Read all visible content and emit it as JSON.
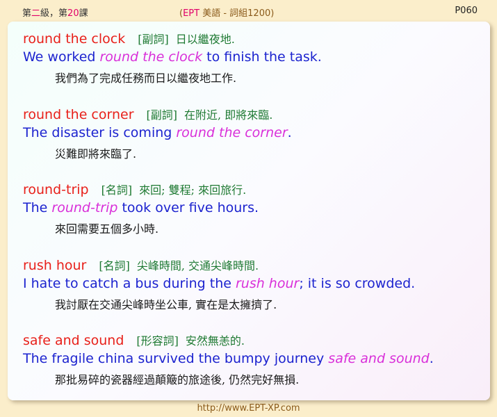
{
  "header": {
    "lesson_prefix": "第",
    "lesson_level": "二",
    "lesson_mid": "級，第",
    "lesson_num": "20",
    "lesson_suffix": "課",
    "book_open": "(",
    "book_ept": "EPT",
    "book_rest": " 美語 - 詞組1200)",
    "page": "P060"
  },
  "entries": [
    {
      "term": "round the clock",
      "pos": "[副詞]",
      "gloss": "日以繼夜地.",
      "example_pre": "We worked ",
      "example_hl": "round the clock",
      "example_post": " to finish the task.",
      "translation": "我們為了完成任務而日以繼夜地工作."
    },
    {
      "term": "round the corner",
      "pos": "[副詞]",
      "gloss": "在附近, 即將來臨.",
      "example_pre": "The disaster is coming ",
      "example_hl": "round the corner",
      "example_post": ".",
      "translation": "災難即將來臨了."
    },
    {
      "term": "round-trip",
      "pos": "[名詞]",
      "gloss": "來回; 雙程; 來回旅行.",
      "example_pre": "The ",
      "example_hl": "round-trip",
      "example_post": " took over five hours.",
      "translation": "來回需要五個多小時."
    },
    {
      "term": "rush hour",
      "pos": "[名詞]",
      "gloss": "尖峰時間, 交通尖峰時間.",
      "example_pre": "I hate to catch a bus during the ",
      "example_hl": "rush hour",
      "example_post": "; it is so crowded.",
      "translation": "我討厭在交通尖峰時坐公車, 實在是太擁擠了."
    },
    {
      "term": "safe and sound",
      "pos": "[形容詞]",
      "gloss": "安然無恙的.",
      "example_pre": "The fragile china survived the bumpy journey ",
      "example_hl": "safe and sound",
      "example_post": ".",
      "translation": "那批易碎的瓷器經過顛簸的旅途後, 仍然完好無損."
    }
  ],
  "footer": {
    "url": "http://www.EPT-XP.com"
  },
  "colors": {
    "term": "#e8201a",
    "part_of_speech": "#1f7a33",
    "example": "#1c23cf",
    "highlight": "#d92fd9",
    "translation": "#1a1a1a",
    "background": "#fbeecb"
  }
}
